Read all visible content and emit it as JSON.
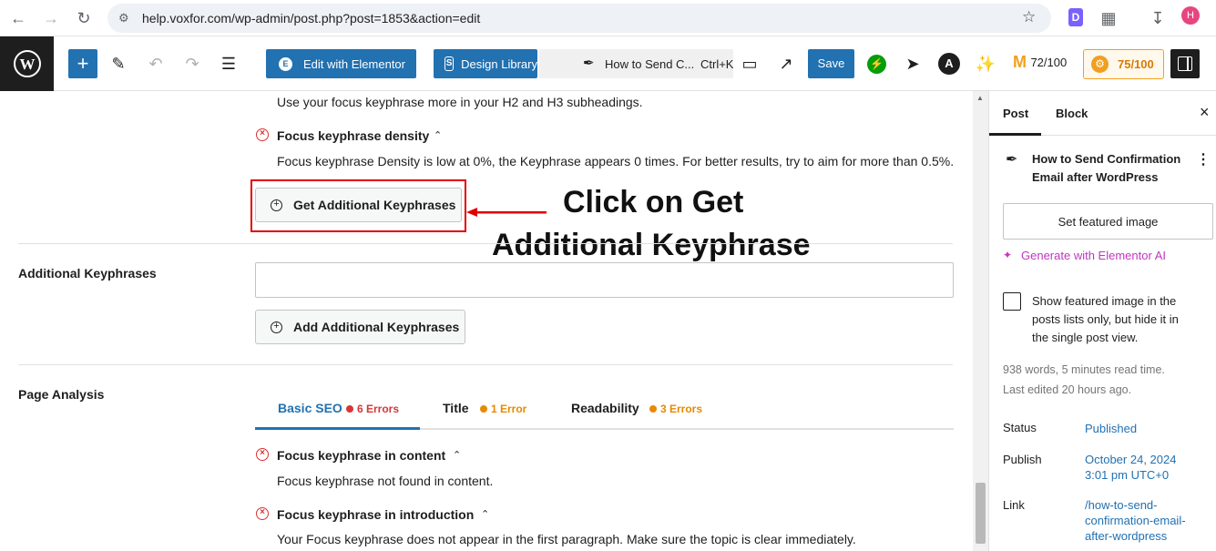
{
  "browser": {
    "url": "help.voxfor.com/wp-admin/post.php?post=1853&action=edit",
    "profile_initial": "H"
  },
  "toolbar": {
    "edit_elementor_label": "Edit with Elementor",
    "design_library_label": "Design Library",
    "command_title": "How to Send C...",
    "command_shortcut": "Ctrl+K",
    "save_label": "Save",
    "seo_score": "72/100",
    "readability_score": "75/100"
  },
  "main": {
    "h2_desc": "Use your focus keyphrase more in your H2 and H3 subheadings.",
    "density_title": "Focus keyphrase density",
    "density_desc": "Focus keyphrase Density is low at 0%, the Keyphrase appears 0 times. For better results, try to aim for more than 0.5%.",
    "get_additional_label": "Get Additional Keyphrases",
    "annotation_line1": "Click on Get",
    "annotation_line2": "Additional Keyphrase",
    "additional_keyphrases_label": "Additional Keyphrases",
    "add_additional_label": "Add Additional Keyphrases",
    "page_analysis_label": "Page Analysis",
    "tabs": [
      {
        "label": "Basic SEO",
        "count": "6 Errors",
        "color": "#d63638"
      },
      {
        "label": "Title",
        "count": "1 Error",
        "color": "#e68a00"
      },
      {
        "label": "Readability",
        "count": "3 Errors",
        "color": "#e68a00"
      }
    ],
    "content_title": "Focus keyphrase in content",
    "content_desc": "Focus keyphrase not found in content.",
    "intro_title": "Focus keyphrase in introduction",
    "intro_desc": "Your Focus keyphrase does not appear in the first paragraph. Make sure the topic is clear immediately."
  },
  "sidebar": {
    "tab_post": "Post",
    "tab_block": "Block",
    "post_title_line1": "How to Send Confirmation",
    "post_title_line2": "Email after WordPress",
    "featured_image_label": "Set featured image",
    "generate_ai_label": "Generate with Elementor AI",
    "show_featured_line1": "Show featured image in the",
    "show_featured_line2": "posts lists only, but hide it in",
    "show_featured_line3": "the single post view.",
    "word_count": "938 words, 5 minutes read time.",
    "last_edited": "Last edited 20 hours ago.",
    "status_label": "Status",
    "status_value": "Published",
    "publish_label": "Publish",
    "publish_date": "October 24, 2024",
    "publish_time": "3:01 pm UTC+0",
    "link_label": "Link",
    "link_line1": "/how-to-send-",
    "link_line2": "confirmation-email-",
    "link_line3": "after-wordpress"
  },
  "colors": {
    "accent": "#2271b1",
    "error": "#dc3232",
    "annotation": "#e00000",
    "elementor_ai": "#c036c0"
  }
}
